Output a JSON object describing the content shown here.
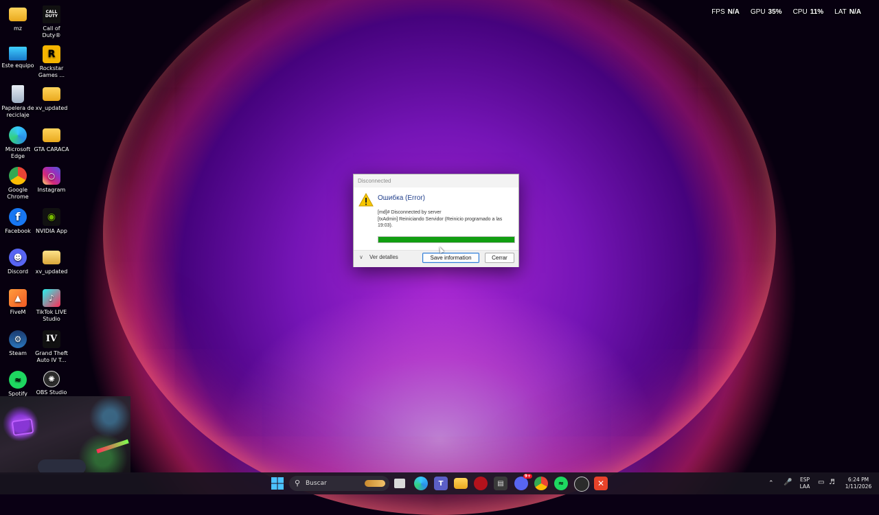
{
  "overlay": {
    "fps_label": "FPS",
    "fps_value": "N/A",
    "gpu_label": "GPU",
    "gpu_value": "35%",
    "cpu_label": "CPU",
    "cpu_value": "11%",
    "lat_label": "LAT",
    "lat_value": "N/A"
  },
  "desktop": {
    "icons": [
      {
        "label": "mz",
        "icon": "folder-icon"
      },
      {
        "label": "Call of Duty®",
        "icon": "call-of-duty-icon",
        "badge": "CALL DUTY"
      },
      {
        "label": "Este equipo",
        "icon": "computer-icon"
      },
      {
        "label": "Rockstar Games ...",
        "icon": "rockstar-icon",
        "badge": "R"
      },
      {
        "label": "Papelera de reciclaje",
        "icon": "recycle-bin-icon"
      },
      {
        "label": "xv_updated",
        "icon": "folder-icon"
      },
      {
        "label": "Microsoft Edge",
        "icon": "edge-icon"
      },
      {
        "label": "GTA CARACA",
        "icon": "folder-icon"
      },
      {
        "label": "Google Chrome",
        "icon": "chrome-icon"
      },
      {
        "label": "Instagram",
        "icon": "instagram-icon"
      },
      {
        "label": "Facebook",
        "icon": "facebook-icon",
        "badge": "f"
      },
      {
        "label": "NVIDIA App",
        "icon": "nvidia-icon"
      },
      {
        "label": "Discord",
        "icon": "discord-icon"
      },
      {
        "label": "xv_updated",
        "icon": "archive-icon"
      },
      {
        "label": "FiveM",
        "icon": "fivem-icon"
      },
      {
        "label": "TikTok LIVE Studio",
        "icon": "tiktok-icon"
      },
      {
        "label": "Steam",
        "icon": "steam-icon"
      },
      {
        "label": "Grand Theft Auto IV T...",
        "icon": "gta-iv-icon",
        "badge": "IV"
      },
      {
        "label": "Spotify",
        "icon": "spotify-icon"
      },
      {
        "label": "OBS Studio",
        "icon": "obs-icon"
      }
    ]
  },
  "dialog": {
    "title": "Disconnected",
    "heading": "Ошибка (Error)",
    "line1": "[md]# Disconnected by server",
    "line2": "[txAdmin] Reiniciando Servidor (Reinicio programado a las 19:03).",
    "progress": 1.0,
    "details_label": "Ver detalles",
    "save_label": "Save information",
    "close_label": "Cerrar"
  },
  "taskbar": {
    "search_placeholder": "Buscar",
    "discord_badge": "9+",
    "tray": {
      "lang": "ESP",
      "layout": "LAA",
      "time": "6:24 PM",
      "date": "1/11/2026"
    }
  },
  "colors": {
    "progress_fill": "#119e11",
    "dialog_heading": "#1f3d8a",
    "accent_button": "#2d7ad6"
  }
}
